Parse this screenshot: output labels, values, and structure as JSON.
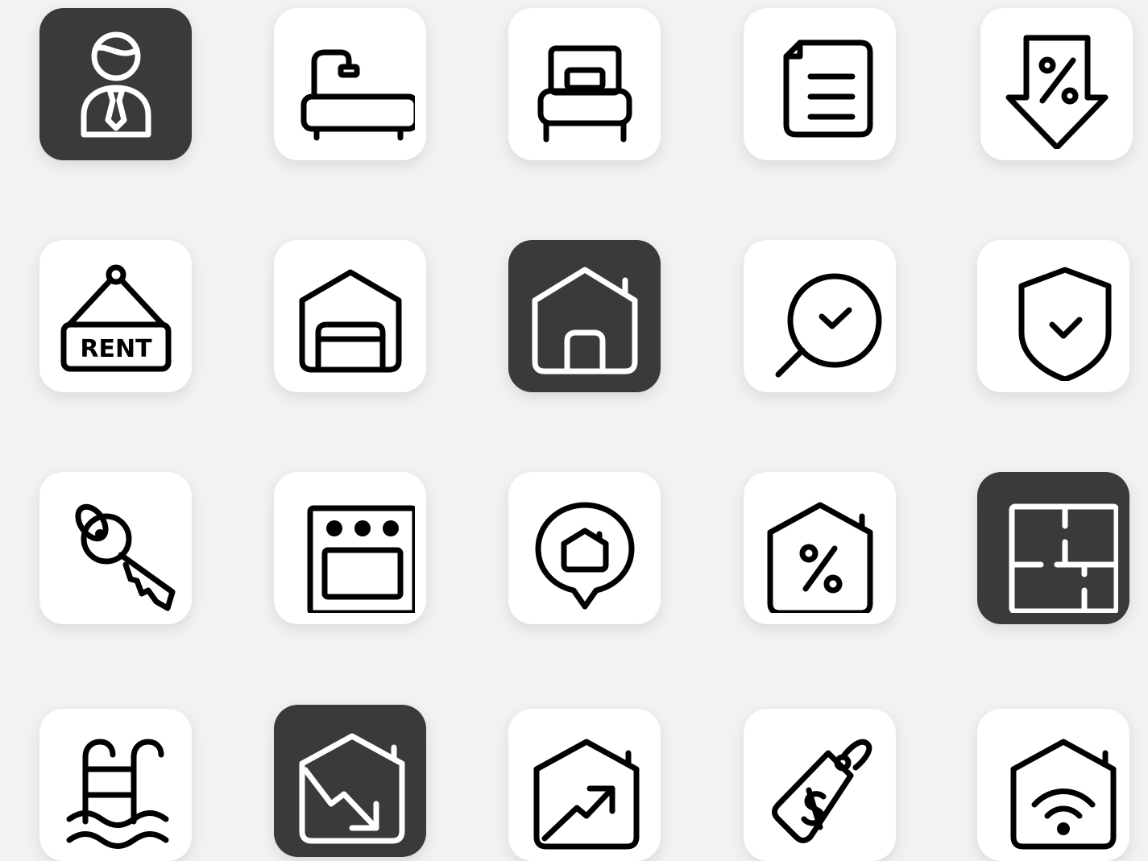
{
  "sign": {
    "rent_text": "RENT"
  },
  "icons": [
    {
      "name": "real-estate-agent-icon",
      "style": "dark"
    },
    {
      "name": "bathtub-icon",
      "style": "light"
    },
    {
      "name": "bed-icon",
      "style": "light"
    },
    {
      "name": "document-icon",
      "style": "light"
    },
    {
      "name": "price-down-percent-icon",
      "style": "light"
    },
    {
      "name": "rent-sign-icon",
      "style": "light"
    },
    {
      "name": "garage-icon",
      "style": "light"
    },
    {
      "name": "home-icon",
      "style": "dark"
    },
    {
      "name": "search-check-icon",
      "style": "light"
    },
    {
      "name": "shield-check-icon",
      "style": "light"
    },
    {
      "name": "key-icon",
      "style": "light"
    },
    {
      "name": "oven-icon",
      "style": "light"
    },
    {
      "name": "home-location-pin-icon",
      "style": "light"
    },
    {
      "name": "home-discount-icon",
      "style": "light"
    },
    {
      "name": "floor-plan-icon",
      "style": "dark"
    },
    {
      "name": "swimming-pool-icon",
      "style": "light"
    },
    {
      "name": "home-value-down-icon",
      "style": "dark"
    },
    {
      "name": "home-value-up-icon",
      "style": "light"
    },
    {
      "name": "price-tag-dollar-icon",
      "style": "light"
    },
    {
      "name": "smart-home-wifi-icon",
      "style": "light"
    }
  ],
  "colors": {
    "background": "#f2f2f2",
    "tile_light": "#ffffff",
    "tile_dark": "#3a3a3a",
    "stroke": "#000000"
  }
}
